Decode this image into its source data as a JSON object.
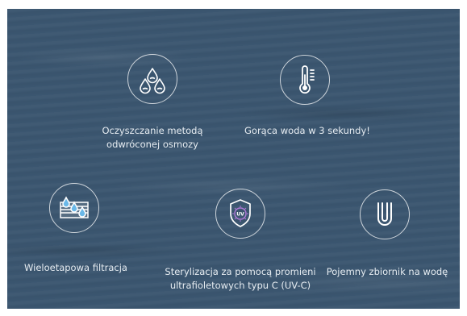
{
  "features": [
    {
      "icon": "water-drops-icon",
      "lines": [
        "Oczyszczanie metodą",
        "odwróconej osmozy"
      ]
    },
    {
      "icon": "thermometer-icon",
      "lines": [
        "Gorąca woda w 3 sekundy!"
      ]
    },
    {
      "icon": "filtration-layers-icon",
      "lines": [
        "Wieloetapowa filtracja"
      ]
    },
    {
      "icon": "uv-shield-icon",
      "icon_text": "UV",
      "lines": [
        "Sterylizacja za pomocą promieni",
        "ultrafioletowych typu C (UV-C)"
      ]
    },
    {
      "icon": "u-shape-tank-icon",
      "lines": [
        "Pojemny zbiornik na wodę"
      ]
    }
  ]
}
